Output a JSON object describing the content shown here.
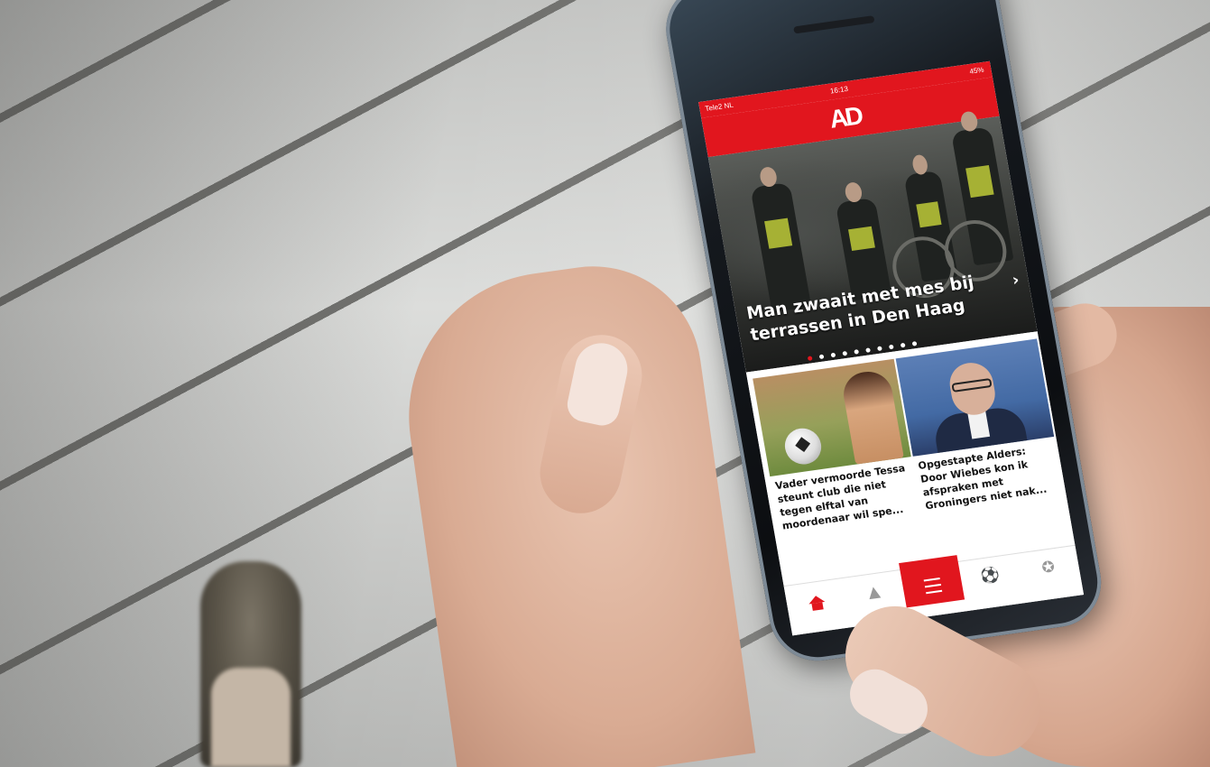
{
  "phone": {
    "status": {
      "carrier": "Tele2 NL",
      "time": "16:13",
      "battery": "45%"
    },
    "brand": {
      "logo": "AD",
      "color": "#e1161e"
    },
    "hero": {
      "title": "Man zwaait met mes bij terrassen in Den Haag",
      "arrow": "›",
      "dots_total": 10,
      "dot_active": 1
    },
    "articles": [
      {
        "title": "Vader vermoorde Tessa steunt club die niet tegen elftal van moordenaar wil spe..."
      },
      {
        "title": "Opgestapte Alders: Door Wiebes kon ik afspraken met Groningers niet nak..."
      }
    ],
    "tabbar": [
      {
        "icon": "home-icon"
      },
      {
        "icon": "bell-icon"
      },
      {
        "icon": "menu-icon"
      },
      {
        "icon": "football-icon"
      },
      {
        "icon": "stars-icon"
      }
    ]
  }
}
